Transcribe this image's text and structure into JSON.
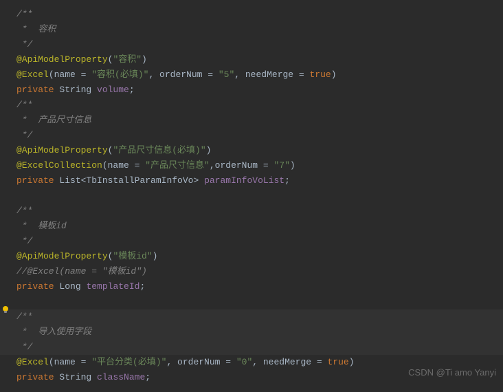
{
  "code": {
    "l1": "/**",
    "l2": " *  容积",
    "l3": " */",
    "l4a": "@ApiModelProperty",
    "l4b": "(",
    "l4c": "\"容积\"",
    "l4d": ")",
    "l5a": "@Excel",
    "l5b": "(name = ",
    "l5c": "\"容积(必填)\"",
    "l5d": ", orderNum = ",
    "l5e": "\"5\"",
    "l5f": ", needMerge = ",
    "l5g": "true",
    "l5h": ")",
    "l6a": "private ",
    "l6b": "String ",
    "l6c": "volume",
    "l6d": ";",
    "l7": "/**",
    "l8": " *  产品尺寸信息",
    "l9": " */",
    "l10a": "@ApiModelProperty",
    "l10b": "(",
    "l10c": "\"产品尺寸信息(必填)\"",
    "l10d": ")",
    "l11a": "@ExcelCollection",
    "l11b": "(name = ",
    "l11c": "\"产品尺寸信息\"",
    "l11d": ",orderNum = ",
    "l11e": "\"7\"",
    "l11f": ")",
    "l12a": "private ",
    "l12b": "List<TbInstallParamInfoVo> ",
    "l12c": "paramInfoVoList",
    "l12d": ";",
    "l13": "",
    "l14": "/**",
    "l15": " *  模板id",
    "l16": " */",
    "l17a": "@ApiModelProperty",
    "l17b": "(",
    "l17c": "\"模板id\"",
    "l17d": ")",
    "l18": "//@Excel(name = \"模板id\")",
    "l19a": "private ",
    "l19b": "Long ",
    "l19c": "templateId",
    "l19d": ";",
    "l20": "",
    "l21": "/**",
    "l22": " *  导入使用字段",
    "l23": " */",
    "l24a": "@Excel",
    "l24b": "(name = ",
    "l24c": "\"平台分类(必填)\"",
    "l24d": ", orderNum = ",
    "l24e": "\"0\"",
    "l24f": ", needMerge = ",
    "l24g": "true",
    "l24h": ")",
    "l25a": "private ",
    "l25b": "String ",
    "l25c": "className",
    "l25d": ";"
  },
  "watermark": "CSDN @Ti amo Yanyi"
}
